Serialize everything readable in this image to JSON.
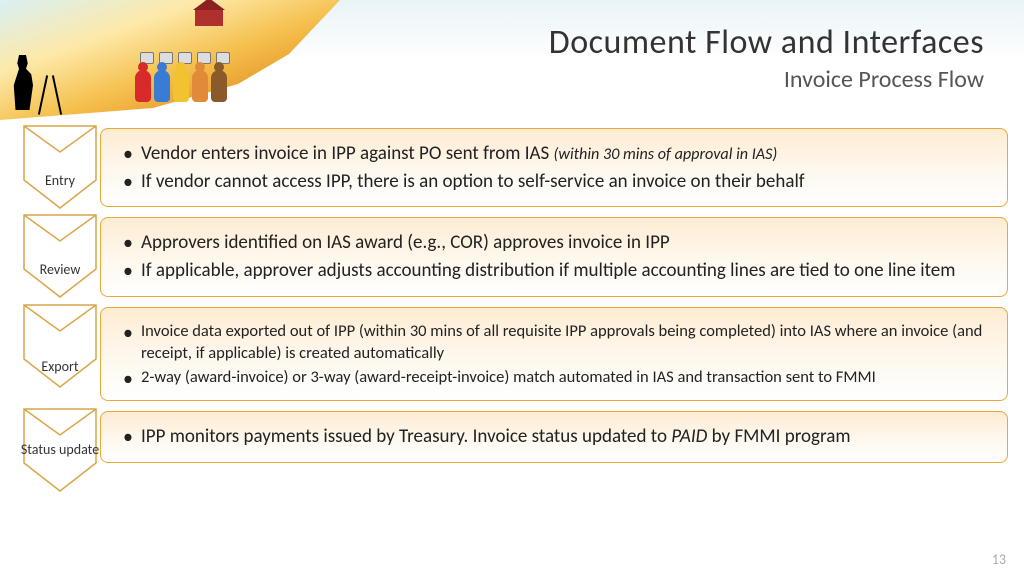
{
  "title": {
    "main": "Document Flow and Interfaces",
    "sub": "Invoice Process Flow"
  },
  "page_number": "13",
  "colors": {
    "chevron_border": "#d9a648",
    "box_border": "#e8a83a"
  },
  "people_colors": [
    "#d82a2a",
    "#3a7bd5",
    "#f2c230",
    "#e08a3a",
    "#8a5a2a"
  ],
  "steps": [
    {
      "label": "Entry",
      "size": "normal",
      "bullets": [
        {
          "t": "Vendor enters invoice in IPP against PO sent from IAS ",
          "note": "(within 30 mins of approval in IAS)"
        },
        {
          "t": "If vendor cannot access IPP, there is an option to self-service an invoice on their behalf"
        }
      ]
    },
    {
      "label": "Review",
      "size": "normal",
      "bullets": [
        {
          "t": "Approvers identified on IAS award (e.g., COR) approves invoice in IPP"
        },
        {
          "t": "If applicable, approver adjusts accounting distribution if multiple accounting lines are tied to one line item"
        }
      ]
    },
    {
      "label": "Export",
      "size": "small",
      "bullets": [
        {
          "t": "Invoice data exported out of IPP (within 30 mins of all requisite IPP approvals being completed) into IAS where an invoice (and receipt, if applicable) is created automatically"
        },
        {
          "t": "2-way (award-invoice) or 3-way (award-receipt-invoice) match automated in IAS and transaction sent to FMMI"
        }
      ]
    },
    {
      "label": "Status update",
      "size": "normal",
      "bullets": [
        {
          "t": "IPP monitors payments issued by Treasury. Invoice status updated to ",
          "em": "PAID",
          "t2": " by FMMI program"
        }
      ]
    }
  ]
}
